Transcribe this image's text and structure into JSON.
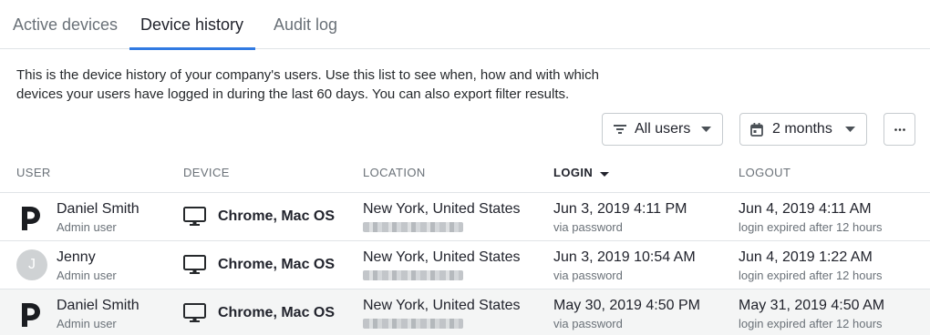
{
  "tabs": [
    {
      "label": "Active devices",
      "active": false
    },
    {
      "label": "Device history",
      "active": true
    },
    {
      "label": "Audit log",
      "active": false
    }
  ],
  "description": {
    "line1": "This is the device history of your company's users. Use this list to see when, how and with which",
    "line2": "devices your users have logged in during the last 60 days. You can also export filter results."
  },
  "filters": {
    "users_label": "All users",
    "period_label": "2 months",
    "more_icon": "ellipsis-icon"
  },
  "columns": {
    "user": "USER",
    "device": "DEVICE",
    "location": "LOCATION",
    "login": "LOGIN",
    "logout": "LOGOUT",
    "sorted_by": "LOGIN",
    "sort_direction": "descending"
  },
  "rows": [
    {
      "avatar": "p-logo",
      "avatar_initial": "",
      "name": "Daniel Smith",
      "role": "Admin user",
      "device": "Chrome, Mac OS",
      "location": "New York, United States",
      "login": "Jun 3, 2019 4:11 PM",
      "login_via": "via password",
      "logout": "Jun 4, 2019 4:11 AM",
      "logout_reason": "login expired after 12 hours",
      "highlighted": false
    },
    {
      "avatar": "initial",
      "avatar_initial": "J",
      "name": "Jenny",
      "role": "Admin user",
      "device": "Chrome, Mac OS",
      "location": "New York, United States",
      "login": "Jun 3, 2019 10:54 AM",
      "login_via": "via password",
      "logout": "Jun 4, 2019 1:22 AM",
      "logout_reason": "login expired after 12 hours",
      "highlighted": false
    },
    {
      "avatar": "p-logo",
      "avatar_initial": "",
      "name": "Daniel Smith",
      "role": "Admin user",
      "device": "Chrome, Mac OS",
      "location": "New York, United States",
      "login": "May 30, 2019 4:50 PM",
      "login_via": "via password",
      "logout": "May 31, 2019 4:50 AM",
      "logout_reason": "login expired after 12 hours",
      "highlighted": true
    }
  ],
  "colors": {
    "accent": "#317ae2",
    "text": "#21232c",
    "muted": "#6a7178",
    "border": "#e0e4e7",
    "row_highlight": "#f4f5f5"
  }
}
